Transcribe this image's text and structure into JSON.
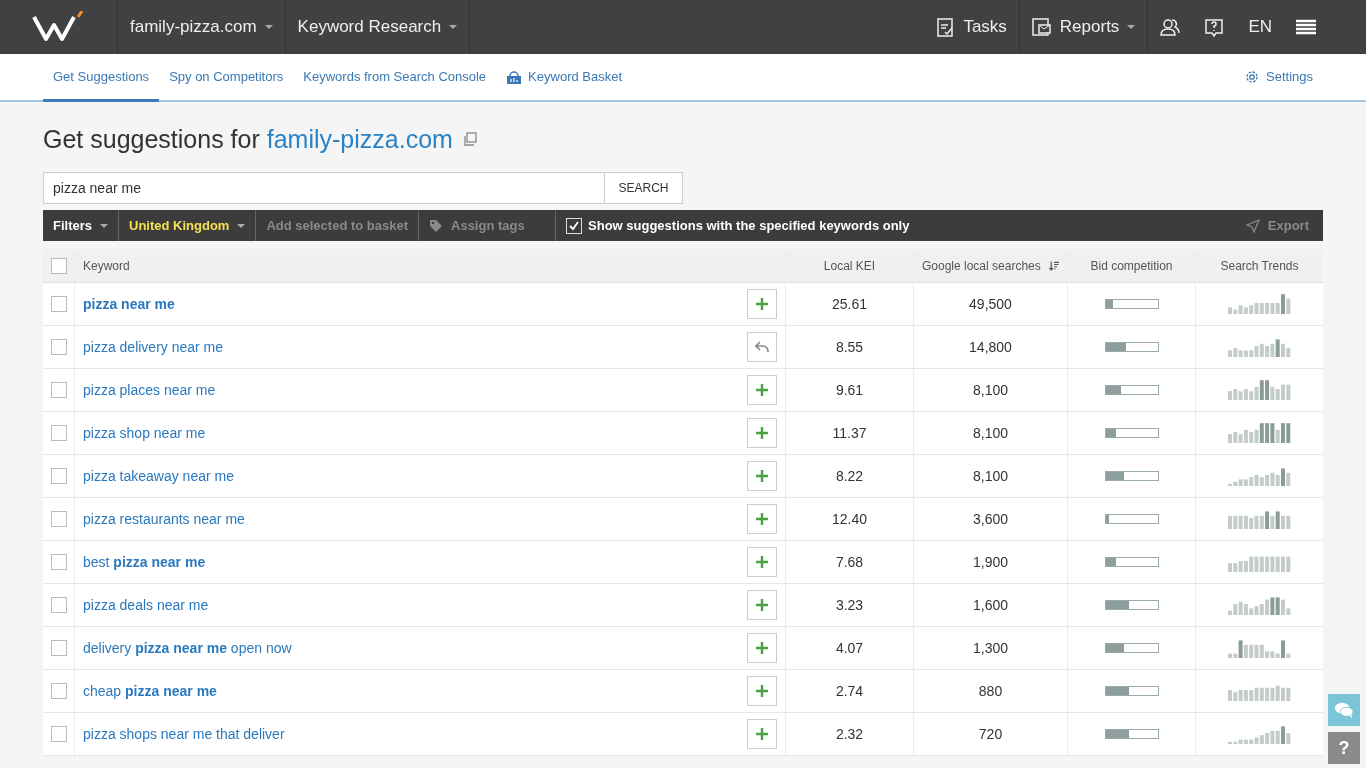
{
  "topbar": {
    "project": "family-pizza.com",
    "module": "Keyword Research",
    "tasks": "Tasks",
    "reports": "Reports",
    "language": "EN"
  },
  "subnav": {
    "tabs": [
      {
        "label": "Get Suggestions",
        "selected": true,
        "kind": "plain"
      },
      {
        "label": "Spy on Competitors",
        "selected": false,
        "kind": "plain"
      },
      {
        "label": "Keywords from Search Console",
        "selected": false,
        "kind": "plain"
      },
      {
        "label": "Keyword Basket",
        "selected": false,
        "kind": "basket"
      }
    ],
    "settings": "Settings"
  },
  "heading": {
    "prefix": "Get suggestions for",
    "domain": "family-pizza.com"
  },
  "search": {
    "value": "pizza near me",
    "button": "SEARCH"
  },
  "toolbar": {
    "filters": "Filters",
    "country": "United Kingdom",
    "add_to_basket": "Add selected to basket",
    "assign_tags": "Assign tags",
    "only_specified": {
      "label": "Show suggestions with the specified keywords only",
      "checked": true
    },
    "export": "Export"
  },
  "table": {
    "select_all_checked": false,
    "columns": [
      "Keyword",
      "Local KEI",
      "Google local searches",
      "Bid competition",
      "Search Trends"
    ],
    "rows": [
      {
        "keyword": "**pizza near me**",
        "checked": false,
        "kind": "add",
        "kei": "25.61",
        "searches": "49,500",
        "level": 0.15
      },
      {
        "keyword": "pizza delivery near me",
        "checked": false,
        "kind": "undo",
        "kei": "8.55",
        "searches": "14,800",
        "level": 0.4
      },
      {
        "keyword": "pizza places near me",
        "checked": false,
        "kind": "add",
        "kei": "9.61",
        "searches": "8,100",
        "level": 0.3
      },
      {
        "keyword": "pizza shop near me",
        "checked": false,
        "kind": "add",
        "kei": "11.37",
        "searches": "8,100",
        "level": 0.2
      },
      {
        "keyword": "pizza takeaway near me",
        "checked": false,
        "kind": "add",
        "kei": "8.22",
        "searches": "8,100",
        "level": 0.35
      },
      {
        "keyword": "pizza restaurants near me",
        "checked": false,
        "kind": "add",
        "kei": "12.40",
        "searches": "3,600",
        "level": 0.07
      },
      {
        "keyword": "best **pizza near me**",
        "checked": false,
        "kind": "add",
        "kei": "7.68",
        "searches": "1,900",
        "level": 0.2
      },
      {
        "keyword": "pizza deals near me",
        "checked": false,
        "kind": "add",
        "kei": "3.23",
        "searches": "1,600",
        "level": 0.45
      },
      {
        "keyword": "delivery **pizza near me** open now",
        "checked": false,
        "kind": "add",
        "kei": "4.07",
        "searches": "1,300",
        "level": 0.35
      },
      {
        "keyword": "cheap **pizza near me**",
        "checked": false,
        "kind": "add",
        "kei": "2.74",
        "searches": "880",
        "level": 0.45
      },
      {
        "keyword": "pizza shops near me that deliver",
        "checked": false,
        "kind": "add",
        "kei": "2.32",
        "searches": "720",
        "level": 0.45
      }
    ]
  },
  "help_widget": {
    "help": "?"
  }
}
